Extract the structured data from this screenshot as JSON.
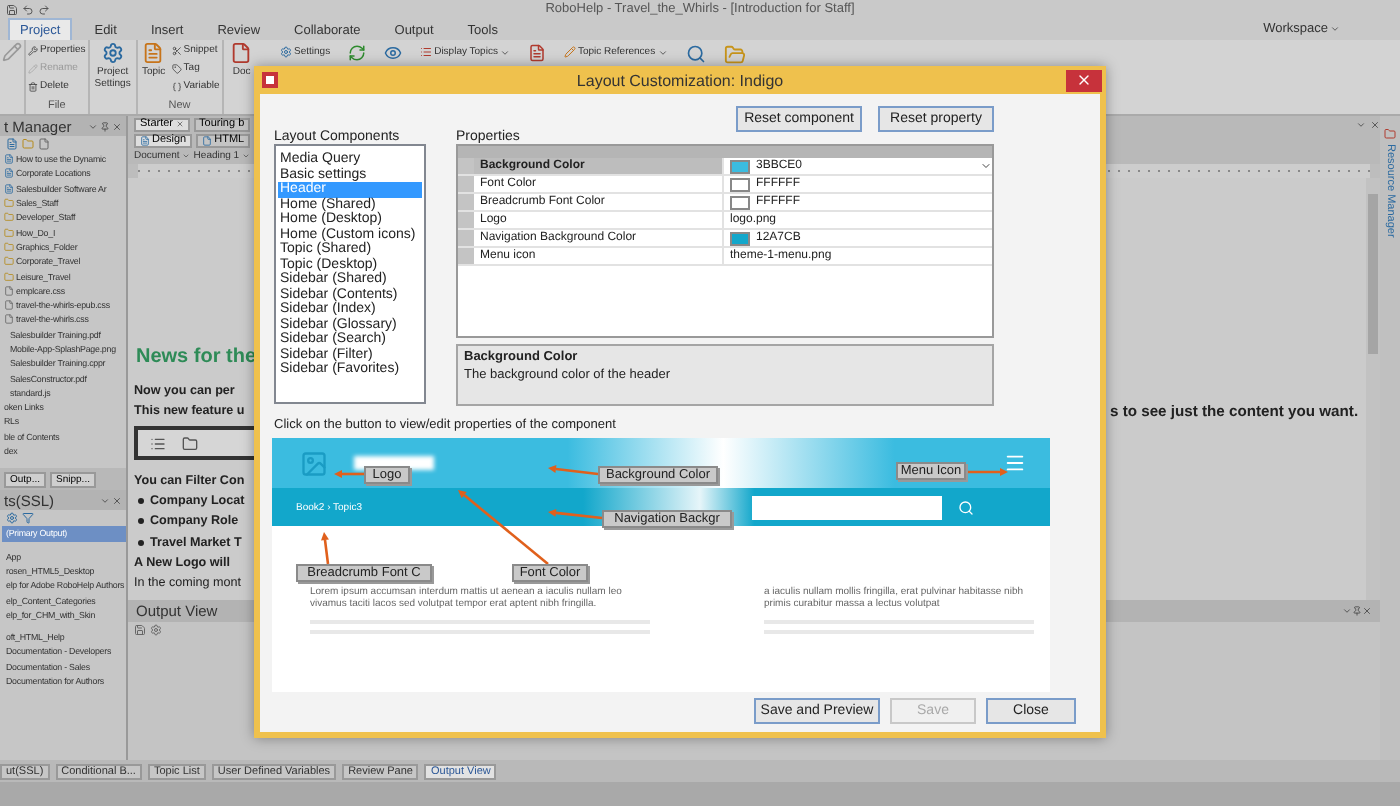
{
  "window": {
    "title": "RoboHelp - Travel_the_Whirls - [Introduction for Staff]"
  },
  "menu_tabs": [
    {
      "label": "Project",
      "selected": true
    },
    {
      "label": "Edit",
      "selected": false
    },
    {
      "label": "Insert",
      "selected": false
    },
    {
      "label": "Review",
      "selected": false
    },
    {
      "label": "Collaborate",
      "selected": false
    },
    {
      "label": "Output",
      "selected": false
    },
    {
      "label": "Tools",
      "selected": false
    }
  ],
  "workspace": {
    "label": "Workspace"
  },
  "ribbon": {
    "file_group": {
      "label": "File",
      "items": [
        {
          "label": "Properties",
          "disabled": false
        },
        {
          "label": "Rename",
          "disabled": true
        },
        {
          "label": "Delete",
          "disabled": false
        }
      ]
    },
    "project_settings": "Project Settings",
    "new_group": {
      "label": "New",
      "large": "Topic",
      "items": [
        "Snippet",
        "Tag",
        "Variable"
      ]
    },
    "doc": "Doc",
    "top_row": [
      "Settings",
      "Display Topics",
      "Topic References"
    ]
  },
  "project_manager": {
    "title": "t Manager",
    "items": [
      {
        "label": "How to use the Dynamic",
        "kind": "topic"
      },
      {
        "label": "Corporate Locations",
        "kind": "topic"
      },
      {
        "label": "Salesbuilder Software Ar",
        "kind": "topic"
      },
      {
        "label": "Sales_Staff",
        "kind": "folder"
      },
      {
        "label": "Developer_Staff",
        "kind": "folder"
      },
      {
        "label": "How_Do_I",
        "kind": "folder"
      },
      {
        "label": "Graphics_Folder",
        "kind": "folder"
      },
      {
        "label": "Corporate_Travel",
        "kind": "folder"
      },
      {
        "label": "Leisure_Travel",
        "kind": "folder"
      },
      {
        "label": "emplcare.css",
        "kind": "file"
      },
      {
        "label": "travel-the-whirls-epub.css",
        "kind": "file"
      },
      {
        "label": "travel-the-whirls.css",
        "kind": "file"
      },
      {
        "label": "Salesbuilder Training.pdf",
        "kind": "plain"
      },
      {
        "label": "Mobile-App-SplashPage.png",
        "kind": "plain"
      },
      {
        "label": "Salesbuilder Training.cppr",
        "kind": "plain"
      },
      {
        "label": "SalesConstructor.pdf",
        "kind": "plain"
      },
      {
        "label": "standard.js",
        "kind": "plain"
      },
      {
        "label": "oken Links",
        "kind": "node"
      },
      {
        "label": "RLs",
        "kind": "node"
      },
      {
        "label": "ble of Contents",
        "kind": "node"
      },
      {
        "label": "dex",
        "kind": "node"
      }
    ],
    "tabs": [
      "Outp...",
      "Snipp..."
    ]
  },
  "outputs": {
    "title": "ts(SSL)",
    "items": [
      {
        "label": "(Primary Output)",
        "selected": true
      },
      {
        "label": "App",
        "selected": false
      },
      {
        "label": "rosen_HTML5_Desktop",
        "selected": false
      },
      {
        "label": "elp for Adobe RoboHelp Authors",
        "selected": false
      },
      {
        "label": "elp_Content_Categories",
        "selected": false
      },
      {
        "label": "elp_for_CHM_with_Skin",
        "selected": false
      },
      {
        "label": "oft_HTML_Help",
        "selected": false
      },
      {
        "label": "Documentation - Developers",
        "selected": false
      },
      {
        "label": "Documentation - Sales",
        "selected": false
      },
      {
        "label": "Documentation for Authors",
        "selected": false
      }
    ]
  },
  "editor": {
    "doc_tabs": [
      {
        "label": "Starter",
        "selected": true
      },
      {
        "label": "Touring b",
        "selected": false
      }
    ],
    "view_tabs": [
      {
        "label": "Design",
        "selected": true
      },
      {
        "label": "HTML",
        "selected": false
      }
    ],
    "style_dropdowns": [
      "Document",
      "Heading 1"
    ],
    "heading": "News for the",
    "lines": [
      {
        "kind": "para",
        "text": "Now you can per"
      },
      {
        "kind": "para",
        "text": "This new feature u",
        "tail": "s to see just the content you want."
      },
      {
        "kind": "toolbar"
      },
      {
        "kind": "para",
        "text": "You can Filter Con"
      },
      {
        "kind": "bullet",
        "text": "Company Locat"
      },
      {
        "kind": "bullet",
        "text": "Company Role"
      },
      {
        "kind": "bullet",
        "text": "Travel Market T"
      },
      {
        "kind": "para",
        "text": "A New Logo will"
      },
      {
        "kind": "small",
        "text": "In the coming mont"
      }
    ]
  },
  "output_view": {
    "title": "Output View"
  },
  "resource_manager": "Resource Manager",
  "bottom_tabs": [
    {
      "label": "ut(SSL)",
      "selected": false
    },
    {
      "label": "Conditional B...",
      "selected": false
    },
    {
      "label": "Topic List",
      "selected": false
    },
    {
      "label": "User Defined Variables",
      "selected": false
    },
    {
      "label": "Review Pane",
      "selected": false
    },
    {
      "label": "Output View",
      "selected": true
    }
  ],
  "dialog": {
    "title": "Layout Customization: Indigo",
    "top_buttons": [
      "Reset component",
      "Reset property"
    ],
    "components_label": "Layout Components",
    "components": [
      {
        "label": "Media Query",
        "selected": false
      },
      {
        "label": "Basic settings",
        "selected": false
      },
      {
        "label": "Header",
        "selected": true
      },
      {
        "label": "Home (Shared)",
        "selected": false
      },
      {
        "label": "Home (Desktop)",
        "selected": false
      },
      {
        "label": "Home (Custom icons)",
        "selected": false
      },
      {
        "label": "Topic (Shared)",
        "selected": false
      },
      {
        "label": "Topic (Desktop)",
        "selected": false
      },
      {
        "label": "Sidebar (Shared)",
        "selected": false
      },
      {
        "label": "Sidebar (Contents)",
        "selected": false
      },
      {
        "label": "Sidebar (Index)",
        "selected": false
      },
      {
        "label": "Sidebar (Glossary)",
        "selected": false
      },
      {
        "label": "Sidebar (Search)",
        "selected": false
      },
      {
        "label": "Sidebar (Filter)",
        "selected": false
      },
      {
        "label": "Sidebar (Favorites)",
        "selected": false
      }
    ],
    "properties_label": "Properties",
    "properties": [
      {
        "name": "Background Color",
        "color": "#3bbce0",
        "value": "3BBCE0",
        "selected": true
      },
      {
        "name": "Font Color",
        "color": "#ffffff",
        "value": "FFFFFF",
        "selected": false
      },
      {
        "name": "Breadcrumb Font Color",
        "color": "#ffffff",
        "value": "FFFFFF",
        "selected": false
      },
      {
        "name": "Logo",
        "value": "logo.png",
        "selected": false
      },
      {
        "name": "Navigation Background Color",
        "color": "#12a7cb",
        "value": "12A7CB",
        "selected": false
      },
      {
        "name": "Menu icon",
        "value": "theme-1-menu.png",
        "selected": false
      }
    ],
    "description": {
      "title": "Background Color",
      "text": "The background color of the header"
    },
    "instruction": "Click on the button to view/edit properties of the component",
    "preview": {
      "breadcrumb": "Book2 › Topic3",
      "callouts": [
        "Logo",
        "Background Color",
        "Menu Icon",
        "Navigation Backgr",
        "Breadcrumb Font C",
        "Font Color"
      ],
      "body_left": "Lorem ipsum accumsan interdum mattis ut aenean a iaculis nullam leo vivamus taciti lacos sed volutpat tempor erat aptent nibh fringilla.",
      "body_right": "a iaculis nullam mollis fringilla, erat pulvinar habitasse nibh primis curabitur massa a lectus volutpat"
    },
    "buttons": [
      {
        "label": "Save and Preview",
        "disabled": false
      },
      {
        "label": "Save",
        "disabled": true
      },
      {
        "label": "Close",
        "disabled": false
      }
    ]
  }
}
